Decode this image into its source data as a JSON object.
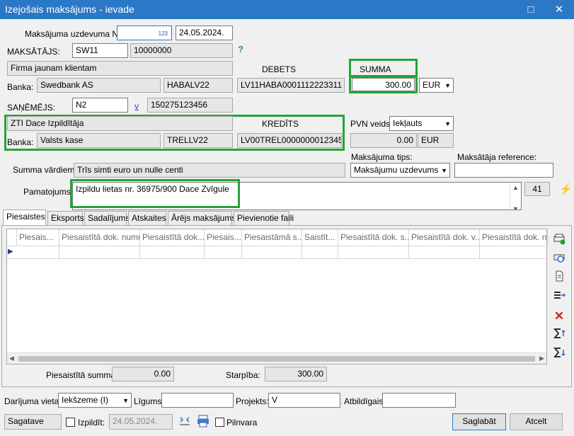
{
  "window": {
    "title": "Izejošais maksājums - ievade",
    "minimize": "□",
    "close": "✕"
  },
  "header": {
    "doc_number_label": "Maksājuma uzdevuma Nr.",
    "doc_number_badge": "123",
    "doc_date": "24.05.2024.",
    "payer_label": "MAKSĀTĀJS:",
    "payer_code": "SW11",
    "payer_regnr": "10000000",
    "help": "?",
    "payer_name": "Firma jaunam klientam",
    "debit_label": "DEBETS",
    "amount_label": "SUMMA",
    "payer_bank_label": "Banka:",
    "payer_bank": "Swedbank AS",
    "payer_swift": "HABALV22",
    "payer_account": "LV11HABA0001112223311",
    "amount": "300.00",
    "currency": "EUR",
    "recipient_label": "SAŅĒMĒJS:",
    "recipient_code": "N2",
    "v_label": "v",
    "recipient_regnr": "150275123456",
    "recipient_name": "ZTI Dace Izpildītāja",
    "credit_label": "KREDĪTS",
    "vat_label": "PVN veids:",
    "vat_type": "Iekļauts",
    "recipient_bank_label": "Banka:",
    "recipient_bank": "Valsts kase",
    "recipient_swift": "TRELLV22",
    "recipient_account": "LV00TREL0000000012345",
    "vat_amount": "0.00",
    "vat_currency": "EUR",
    "payment_type_label": "Maksājuma tips:",
    "payer_ref_label": "Maksātāja reference:",
    "amount_words_label": "Summa vārdiem:",
    "amount_words": "Trīs simti euro un nulle centi",
    "payment_type": "Maksājumu uzdevums",
    "payer_ref": "",
    "purpose_label": "Pamatojums:",
    "purpose": "Izpildu lietas nr. 36975/900 Dace Zvīgule",
    "purpose_length": "41"
  },
  "tabs": [
    "Piesaistes",
    "Eksports",
    "Sadalījums",
    "Atskaites",
    "Ārējs maksājums",
    "Pievienotie faili"
  ],
  "grid": {
    "columns": [
      "Piesais...",
      "Piesaistītā dok. numurs",
      "Piesaistītā dok....",
      "Piesais...",
      "Piesaistāmā s...",
      "Saistīt...",
      "Piesaistītā dok. s...",
      "Piesaistītā dok. v...",
      "Piesaistītā dok. n..."
    ],
    "row_marker": "▶"
  },
  "totals": {
    "linked_sum_label": "Piesaistītā summa:",
    "linked_sum": "0.00",
    "difference_label": "Starpība:",
    "difference": "300.00"
  },
  "footer": {
    "place_label": "Darījuma vieta:",
    "place": "Iekšzeme (I)",
    "contract_label": "Līgums:",
    "contract": "",
    "project_label": "Projekts:",
    "project": "V",
    "responsible_label": "Atbildīgais:",
    "responsible": "",
    "status": "Sagatave",
    "executed_label": "Izpildīt:",
    "executed_date": "24.05.2024.",
    "power_of_attorney_label": "Pilnvara",
    "save_label": "Saglabāt",
    "cancel_label": "Atcelt"
  },
  "colors": {
    "titlebar": "#2b78c7",
    "highlight": "#25a33a",
    "delete_icon": "#d42020"
  },
  "icons": [
    "link-add-icon",
    "link-search-icon",
    "document-icon",
    "list-arrow-icon",
    "delete-icon",
    "sum-up-icon",
    "sum-down-icon",
    "lightning-icon",
    "print-icon",
    "date-arrows-icon"
  ]
}
